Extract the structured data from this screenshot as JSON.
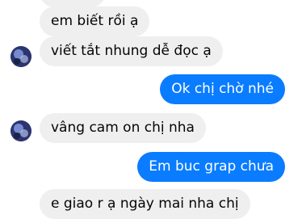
{
  "messages": [
    {
      "side": "incoming",
      "text": ""
    },
    {
      "side": "incoming",
      "text": "em biết rồi ạ"
    },
    {
      "side": "incoming",
      "text": "viết tắt nhung dễ đọc ạ"
    },
    {
      "side": "outgoing",
      "text": "Ok chị chờ nhé"
    },
    {
      "side": "incoming",
      "text": "vâng cam on chị nha"
    },
    {
      "side": "outgoing",
      "text": "Em buc grap chưa"
    },
    {
      "side": "incoming",
      "text": "e giao r ạ ngày mai nha chị"
    }
  ],
  "colors": {
    "incoming_bubble": "#efefef",
    "outgoing_bubble": "#0a7cff"
  }
}
